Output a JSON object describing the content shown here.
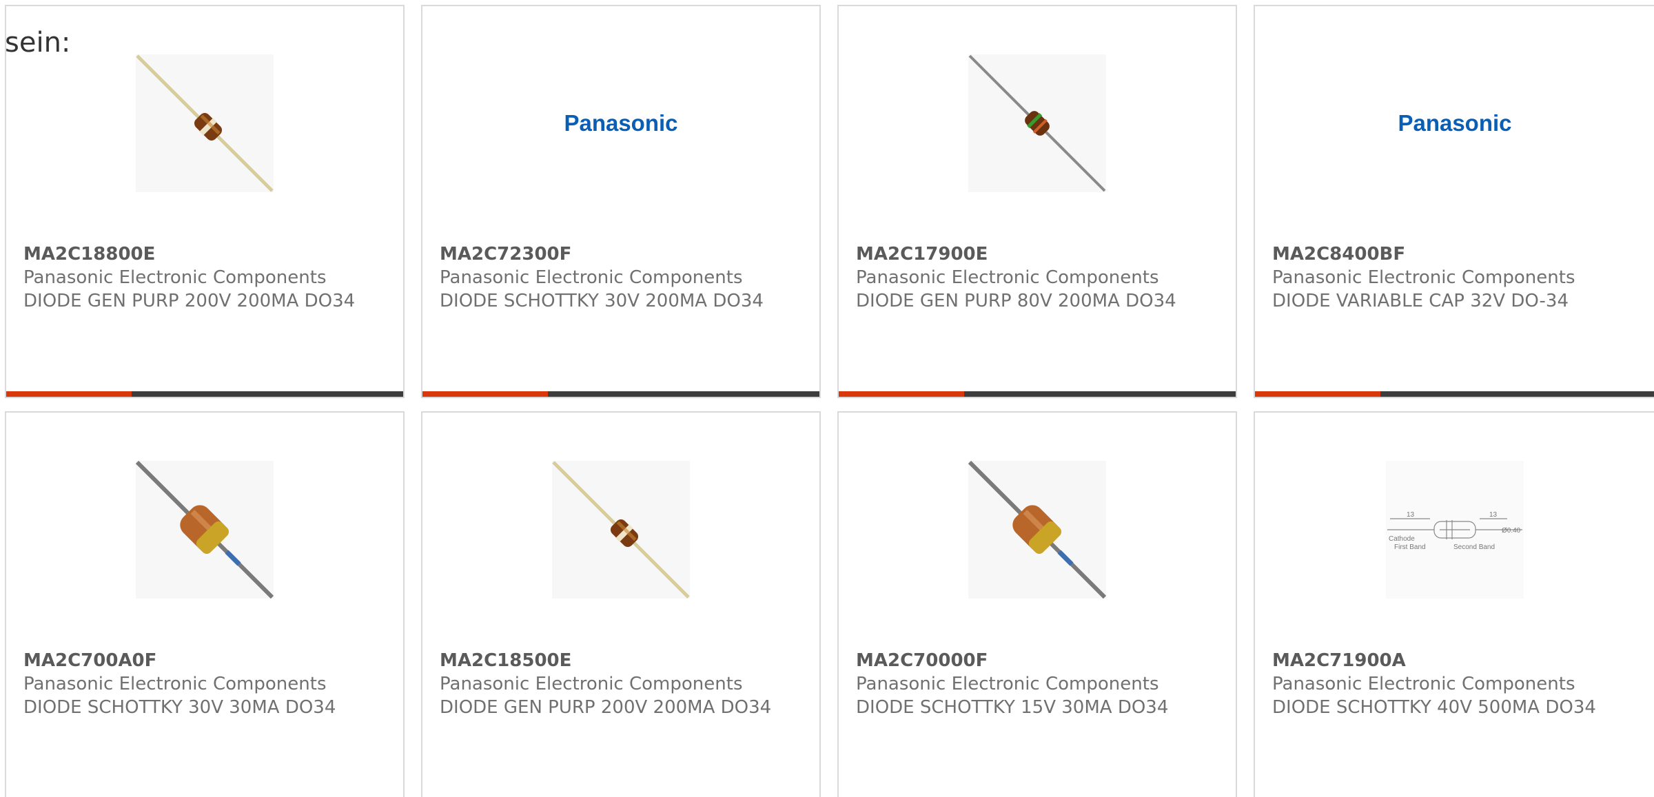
{
  "intro_text": "sein:",
  "colors": {
    "accent": "#d9380d",
    "bar": "#3d3d3d",
    "border": "#d9d9d9",
    "brand_panasonic": "#0a5fb4"
  },
  "products": [
    {
      "part_number": "MA2C18800E",
      "manufacturer": "Panasonic Electronic Components",
      "description": "DIODE GEN PURP 200V 200MA DO34",
      "image": "diode-tan-image"
    },
    {
      "part_number": "MA2C72300F",
      "manufacturer": "Panasonic Electronic Components",
      "description": "DIODE SCHOTTKY 30V 200MA DO34",
      "image": "panasonic-logo",
      "logo_text": "Panasonic"
    },
    {
      "part_number": "MA2C17900E",
      "manufacturer": "Panasonic Electronic Components",
      "description": "DIODE GEN PURP 80V 200MA DO34",
      "image": "diode-green-band-image"
    },
    {
      "part_number": "MA2C8400BF",
      "manufacturer": "Panasonic Electronic Components",
      "description": "DIODE VARIABLE CAP 32V DO-34",
      "image": "panasonic-logo",
      "logo_text": "Panasonic"
    },
    {
      "part_number": "MA2C700A0F",
      "manufacturer": "Panasonic Electronic Components",
      "description": "DIODE SCHOTTKY 30V 30MA DO34",
      "image": "diode-yellow-image"
    },
    {
      "part_number": "MA2C18500E",
      "manufacturer": "Panasonic Electronic Components",
      "description": "DIODE GEN PURP 200V 200MA DO34",
      "image": "diode-tan-image"
    },
    {
      "part_number": "MA2C70000F",
      "manufacturer": "Panasonic Electronic Components",
      "description": "DIODE SCHOTTKY 15V 30MA DO34",
      "image": "diode-yellow-image"
    },
    {
      "part_number": "MA2C71900A",
      "manufacturer": "Panasonic Electronic Components",
      "description": "DIODE SCHOTTKY 40V 500MA DO34",
      "image": "diode-drawing-image",
      "drawing_labels": {
        "dim_left": "13",
        "dim_right": "13",
        "diameter": "Ø0.40",
        "cathode": "Cathode",
        "first_band": "First Band",
        "second_band": "Second Band"
      }
    }
  ]
}
